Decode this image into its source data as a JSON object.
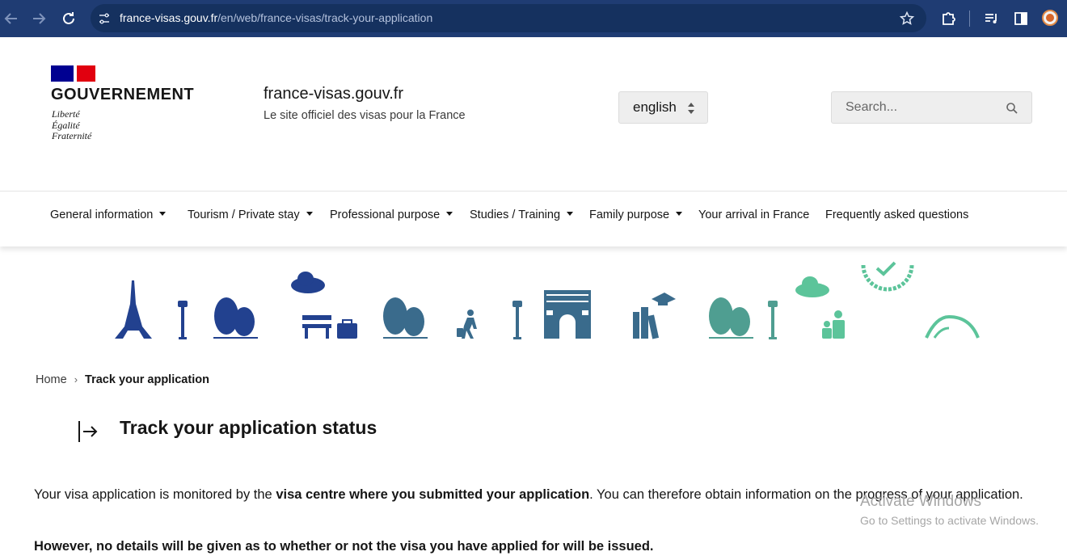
{
  "browser": {
    "url_host": "france-visas.gouv.fr",
    "url_path": "/en/web/france-visas/track-your-application",
    "back_icon": "arrow-left-icon",
    "forward_icon": "arrow-right-icon",
    "reload_icon": "reload-icon",
    "site_info_icon": "tune-icon",
    "bookmark_icon": "star-icon",
    "extensions_icon": "puzzle-icon",
    "media_icon": "playlist-icon",
    "sidepanel_icon": "side-panel-icon",
    "profile_icon": "avatar-icon"
  },
  "header": {
    "gov_name": "GOUVERNEMENT",
    "motto": [
      "Liberté",
      "Égalité",
      "Fraternité"
    ],
    "site_title": "france-visas.gouv.fr",
    "site_subtitle": "Le site officiel des visas pour la France",
    "language": "english",
    "search_placeholder": "Search...",
    "flag_colors": [
      "#000091",
      "#ffffff",
      "#e1000f"
    ]
  },
  "nav": {
    "items": [
      {
        "label": "General information",
        "dropdown": true
      },
      {
        "label": "Tourism / Private stay",
        "dropdown": true
      },
      {
        "label": "Professional purpose",
        "dropdown": true
      },
      {
        "label": "Studies / Training",
        "dropdown": true
      },
      {
        "label": "Family purpose",
        "dropdown": true
      },
      {
        "label": "Your arrival in France",
        "dropdown": false
      },
      {
        "label": "Frequently asked questions",
        "dropdown": false
      }
    ]
  },
  "breadcrumb": {
    "home": "Home",
    "separator": "›",
    "current": "Track your application"
  },
  "main": {
    "title": "Track your application status",
    "para1_a": "Your visa application is monitored by the ",
    "para1_b": "visa centre where you submitted your application",
    "para1_c": ". You can therefore obtain information on the progress of your application.",
    "para2": "However, no details will be given as to whether or not the visa you have applied for will be issued."
  },
  "watermark": {
    "line1": "Activate Windows",
    "line2": "Go to Settings to activate Windows."
  },
  "colors": {
    "chrome_bg": "#1f3c73",
    "illustration_blue": "#22418f",
    "illustration_steel": "#3a6b8c",
    "illustration_teal": "#4f9e91",
    "illustration_green": "#5cc49a"
  }
}
